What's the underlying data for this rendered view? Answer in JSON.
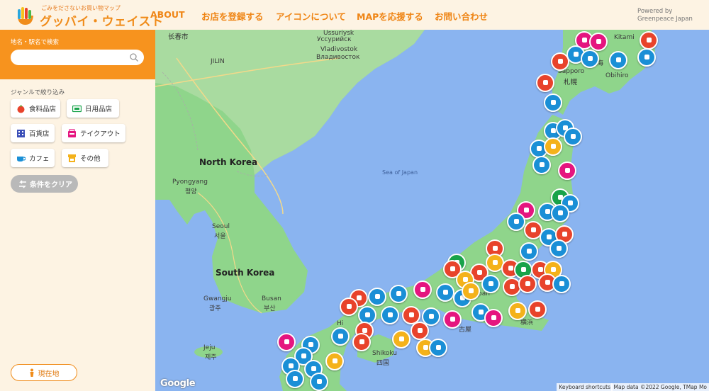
{
  "header": {
    "logo_tagline": "ごみをださないお買い物マップ",
    "logo_title": "グッバイ・ウェイスト",
    "nav": [
      "ABOUT",
      "お店を登録する",
      "アイコンについて",
      "MAPを応援する",
      "お問い合わせ"
    ],
    "powered_line1": "Powered by",
    "powered_line2": "Greenpeace Japan"
  },
  "sidebar": {
    "search_label": "地名・駅名で検索",
    "search_value": "",
    "search_placeholder": "",
    "genre_label": "ジャンルで絞り込み",
    "genres": [
      {
        "label": "食料品店",
        "icon": "apple-icon",
        "color": "#e8432b"
      },
      {
        "label": "日用品店",
        "icon": "bulk-store-icon",
        "color": "#18a34a"
      },
      {
        "label": "百貨店",
        "icon": "building-icon",
        "color": "#3b4fb8"
      },
      {
        "label": "テイクアウト",
        "icon": "takeout-icon",
        "color": "#e5157f"
      },
      {
        "label": "カフェ",
        "icon": "cup-icon",
        "color": "#1a8fd6"
      },
      {
        "label": "その他",
        "icon": "shop-icon",
        "color": "#f4b21b"
      }
    ],
    "clear_label": "条件をクリア",
    "location_label": "現在地"
  },
  "map": {
    "labels": {
      "changchun": "长春市",
      "ussuriysk_en": "Ussuriysk",
      "ussuriysk_ru": "Уссурийск",
      "vladivostok_en": "Vladivostok",
      "vladivostok_ru": "Владивосток",
      "jilin": "JILIN",
      "north_korea": "North Korea",
      "pyongyang_en": "Pyongyang",
      "pyongyang_ko": "평양",
      "seoul_en": "Seoul",
      "seoul_ko": "서울",
      "south_korea": "South Korea",
      "gwangju_en": "Gwangju",
      "gwangju_ko": "광주",
      "busan_en": "Busan",
      "busan_ko": "부산",
      "jeju_en": "Jeju",
      "jeju_ko": "제주",
      "sea_of_japan": "Sea of Japan",
      "kitami": "Kitami",
      "obihiro": "Obihiro",
      "sapporo": "Sapporo",
      "sapporo_ja": "札幌",
      "hokkaido": "北海",
      "shikoku_en": "Shikoku",
      "shikoku_ja": "四国",
      "nagoya_ja": "古屋",
      "yokohama_ja": "横浜",
      "japan_partial": "pan",
      "hi_partial": "Hi"
    },
    "google": "Google",
    "keyboard_shortcuts": "Keyboard shortcuts",
    "map_data": "Map data ©2022 Google, TMap Mo"
  }
}
